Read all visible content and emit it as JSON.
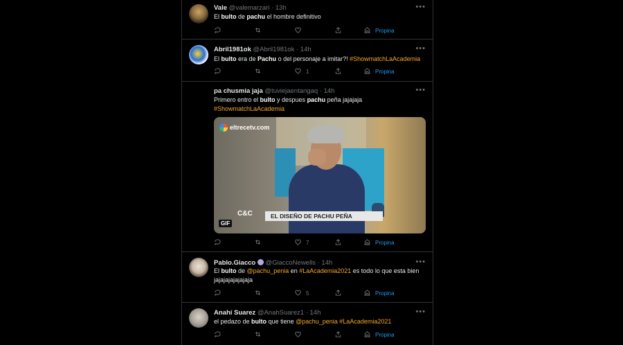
{
  "tweets": [
    {
      "name": "Vale",
      "handle": "@valemarzari",
      "time": "13h",
      "text": [
        {
          "t": "El "
        },
        {
          "b": "bulto"
        },
        {
          "t": " de "
        },
        {
          "b": "pachu"
        },
        {
          "t": " el hombre definitivo"
        }
      ],
      "likes": "",
      "tip_label": "Propina"
    },
    {
      "name": "Abril1981ok",
      "handle": "@Abril1981ok",
      "time": "14h",
      "text": [
        {
          "t": "El "
        },
        {
          "b": "bulto"
        },
        {
          "t": " era de "
        },
        {
          "b": "Pachu"
        },
        {
          "t": " o del personaje a imitar?! "
        },
        {
          "h": "#ShowmatchLaAcademia"
        }
      ],
      "likes": "1",
      "tip_label": "Propina"
    },
    {
      "name": "pa chusmia jaja",
      "handle": "@tuviejaentangaq",
      "time": "14h",
      "text": [
        {
          "t": "Primero entro el "
        },
        {
          "b": "bulto"
        },
        {
          "t": " y despues "
        },
        {
          "b": "pachu"
        },
        {
          "t": " peña jajajaja"
        },
        {
          "br": true
        },
        {
          "h": "#ShowmatchLaAcademia"
        }
      ],
      "likes": "7",
      "tip_label": "Propina",
      "media": {
        "channel_logo": "eltrecetv.com",
        "program_logo": "C&C",
        "lower_third": "EL DISEÑO DE PACHU PEÑA",
        "gif_badge": "GIF"
      }
    },
    {
      "name": "Pablo.Giacco",
      "handle": "@GiaccoNewells",
      "time": "14h",
      "text": [
        {
          "t": "El "
        },
        {
          "b": "bulto"
        },
        {
          "t": " de "
        },
        {
          "h": "@pachu_penia"
        },
        {
          "t": " en "
        },
        {
          "h": "#LaAcademia2021"
        },
        {
          "t": " es todo lo que esta bien jajajajajajajaja"
        }
      ],
      "likes": "5",
      "tip_label": "Propina"
    },
    {
      "name": "Anahí Suarez",
      "handle": "@AnahSuarez1",
      "time": "14h",
      "text": [
        {
          "t": "el pedazo de "
        },
        {
          "b": "bulto"
        },
        {
          "t": " que tiene "
        },
        {
          "h": "@pachu_penia"
        },
        {
          "t": " "
        },
        {
          "h": "#LaAcademia2021"
        }
      ],
      "likes": "",
      "tip_label": "Propina"
    }
  ],
  "colors": {
    "background": "#000000",
    "hashtag": "#f4a82c",
    "muted": "#71767b",
    "divider": "#2f3336"
  },
  "icons": [
    "reply-icon",
    "retweet-icon",
    "like-icon",
    "share-icon",
    "tip-icon",
    "more-icon",
    "verified-badge-icon"
  ]
}
